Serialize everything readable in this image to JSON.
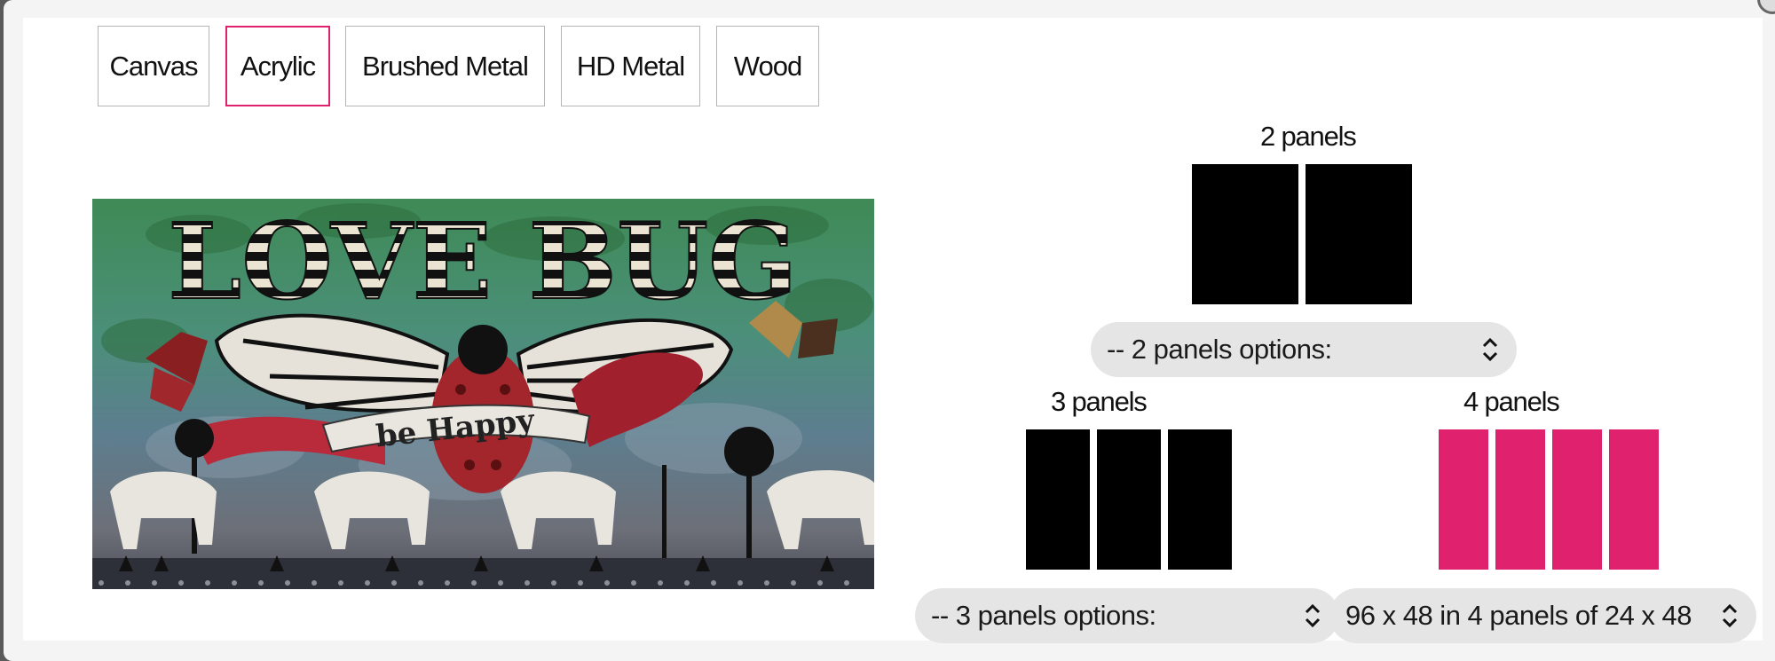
{
  "material_tabs": [
    {
      "label": "Canvas",
      "active": false
    },
    {
      "label": "Acrylic",
      "active": true
    },
    {
      "label": "Brushed Metal",
      "active": false
    },
    {
      "label": "HD Metal",
      "active": false
    },
    {
      "label": "Wood",
      "active": false
    }
  ],
  "artwork": {
    "title_text": "LOVE BUG",
    "banner_text": "be Happy"
  },
  "panel_groups": {
    "two": {
      "label": "2 panels",
      "select_value": "-- 2 panels options:",
      "panel_count": 2,
      "selected": false
    },
    "three": {
      "label": "3 panels",
      "select_value": "-- 3 panels options:",
      "panel_count": 3,
      "selected": false
    },
    "four": {
      "label": "4 panels",
      "select_value": "96 x 48 in 4 panels of 24 x 48",
      "panel_count": 4,
      "selected": true
    }
  },
  "colors": {
    "accent": "#e0226e",
    "panel_default": "#000000",
    "select_bg": "#e5e5e5"
  },
  "icons": {
    "select_arrows": "updown-chevron-icon"
  }
}
